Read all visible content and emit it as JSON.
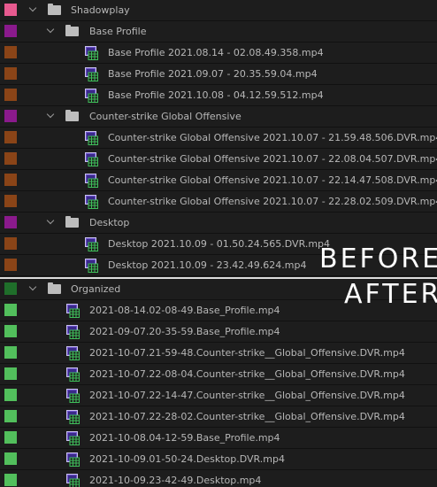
{
  "colors": {
    "pink": "#e75a8f",
    "purple": "#8a1a8c",
    "brown": "#8a4417",
    "dark_green": "#1f6e2a",
    "green": "#52bf5c"
  },
  "before": {
    "root": {
      "label": "Shadowplay",
      "color": "#e75a8f"
    },
    "groups": [
      {
        "label": "Base Profile",
        "color": "#8a1a8c",
        "files": [
          "Base Profile 2021.08.14 - 02.08.49.358.mp4",
          "Base Profile 2021.09.07 - 20.35.59.04.mp4",
          "Base Profile 2021.10.08 - 04.12.59.512.mp4"
        ]
      },
      {
        "label": "Counter-strike  Global Offensive",
        "color": "#8a1a8c",
        "files": [
          "Counter-strike  Global Offensive 2021.10.07 - 21.59.48.506.DVR.mp4",
          "Counter-strike  Global Offensive 2021.10.07 - 22.08.04.507.DVR.mp4",
          "Counter-strike  Global Offensive 2021.10.07 - 22.14.47.508.DVR.mp4",
          "Counter-strike  Global Offensive 2021.10.07 - 22.28.02.509.DVR.mp4"
        ]
      },
      {
        "label": "Desktop",
        "color": "#8a1a8c",
        "files": [
          "Desktop 2021.10.09 - 01.50.24.565.DVR.mp4",
          "Desktop 2021.10.09 - 23.42.49.624.mp4"
        ]
      }
    ],
    "file_color": "#8a4417"
  },
  "after": {
    "root": {
      "label": "Organized",
      "color": "#1f6e2a"
    },
    "files": [
      "2021-08-14.02-08-49.Base_Profile.mp4",
      "2021-09-07.20-35-59.Base_Profile.mp4",
      "2021-10-07.21-59-48.Counter-strike__Global_Offensive.DVR.mp4",
      "2021-10-07.22-08-04.Counter-strike__Global_Offensive.DVR.mp4",
      "2021-10-07.22-14-47.Counter-strike__Global_Offensive.DVR.mp4",
      "2021-10-07.22-28-02.Counter-strike__Global_Offensive.DVR.mp4",
      "2021-10-08.04-12-59.Base_Profile.mp4",
      "2021-10-09.01-50-24.Desktop.DVR.mp4",
      "2021-10-09.23-42-49.Desktop.mp4"
    ],
    "file_color": "#52bf5c"
  },
  "overlay": {
    "before": "BEFORE",
    "after": "AFTER"
  },
  "icons": {
    "folder": "folder-icon",
    "video": "video-clip-icon",
    "chevron": "chevron-down-icon"
  }
}
